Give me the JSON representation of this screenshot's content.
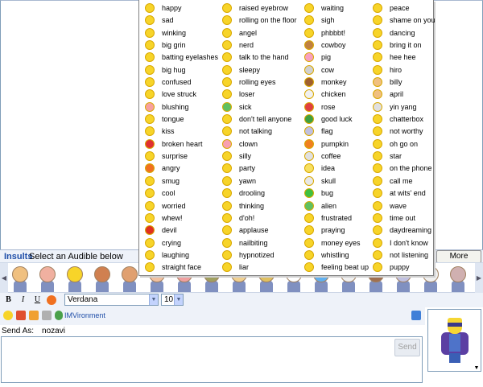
{
  "emoticons": [
    [
      "happy",
      "sad",
      "winking",
      "big grin",
      "batting eyelashes",
      "big hug",
      "confused",
      "love struck",
      "blushing",
      "tongue",
      "kiss",
      "broken heart",
      "surprise",
      "angry",
      "smug",
      "cool",
      "worried",
      "whew!",
      "devil",
      "crying",
      "laughing",
      "straight face"
    ],
    [
      "raised eyebrow",
      "rolling on the floor",
      "angel",
      "nerd",
      "talk to the hand",
      "sleepy",
      "rolling eyes",
      "loser",
      "sick",
      "don't tell anyone",
      "not talking",
      "clown",
      "silly",
      "party",
      "yawn",
      "drooling",
      "thinking",
      "d'oh!",
      "applause",
      "nailbiting",
      "hypnotized",
      "liar"
    ],
    [
      "waiting",
      "sigh",
      "phbbbt!",
      "cowboy",
      "pig",
      "cow",
      "monkey",
      "chicken",
      "rose",
      "good luck",
      "flag",
      "pumpkin",
      "coffee",
      "idea",
      "skull",
      "bug",
      "alien",
      "frustrated",
      "praying",
      "money eyes",
      "whistling",
      "feeling beat up"
    ],
    [
      "peace",
      "shame on you",
      "dancing",
      "bring it on",
      "hee hee",
      "hiro",
      "billy",
      "april",
      "yin yang",
      "chatterbox",
      "not worthy",
      "oh go on",
      "star",
      "on the phone",
      "call me",
      "at wits' end",
      "wave",
      "time out",
      "daydreaming",
      "I don't know",
      "not listening",
      "puppy"
    ]
  ],
  "emoticon_colors": [
    [
      "#f7d429",
      "#f7d429",
      "#f7d429",
      "#f7d429",
      "#f7d429",
      "#f7d429",
      "#f7d429",
      "#f7d429",
      "#f7a0a0",
      "#f7d429",
      "#f7d429",
      "#e03030",
      "#f7d429",
      "#f07020",
      "#f7d429",
      "#f7d429",
      "#f7d429",
      "#f7d429",
      "#e03020",
      "#f7d429",
      "#f7d429",
      "#f7d429"
    ],
    [
      "#f7d429",
      "#f7d429",
      "#f7d429",
      "#f7d429",
      "#f7d429",
      "#f7d429",
      "#f7d429",
      "#f7d429",
      "#60c060",
      "#f7d429",
      "#f7d429",
      "#f8a0b0",
      "#f7d429",
      "#f7d429",
      "#f7d429",
      "#f7d429",
      "#f7d429",
      "#f7d429",
      "#f7d429",
      "#f7d429",
      "#f7d429",
      "#f7d429"
    ],
    [
      "#f7d429",
      "#f7d429",
      "#f7d429",
      "#c08040",
      "#f8a0c0",
      "#d0d0d0",
      "#a06030",
      "#f0f0f0",
      "#e04040",
      "#40a040",
      "#c0c0e0",
      "#f08020",
      "#e0e0e0",
      "#f7e060",
      "#e8e8e8",
      "#40c040",
      "#60c060",
      "#f7d429",
      "#f7d429",
      "#f7d429",
      "#f7d429",
      "#f7d429"
    ],
    [
      "#f7d429",
      "#f7d429",
      "#f7d429",
      "#f7d429",
      "#f7d429",
      "#f7d429",
      "#f0c080",
      "#f0c080",
      "#e0e0e0",
      "#f7d429",
      "#f7d429",
      "#f7d429",
      "#f7d429",
      "#f7d429",
      "#f7d429",
      "#f7d429",
      "#f7d429",
      "#f7d429",
      "#f7d429",
      "#f7d429",
      "#f7d429",
      "#f7d429"
    ]
  ],
  "audibles_bar": {
    "tab_label": "Insults",
    "hint": "Select an Audible below",
    "more_button": "More Audibles"
  },
  "audible_colors": [
    "#f0c080",
    "#f0b0a0",
    "#f7d429",
    "#d08050",
    "#e0a070",
    "#f0c0a0",
    "#f0a0a0",
    "#a0a060",
    "#f0d090",
    "#e0c060",
    "#ffffff",
    "#60b0f0",
    "#f0f0f0",
    "#a07050",
    "#c0c0e0",
    "#f0f0f0",
    "#d0b0b0"
  ],
  "format_bar": {
    "bold": "B",
    "italic": "I",
    "underline": "U",
    "font": "Verdana",
    "size": "10",
    "dropdown_arrow": "▼"
  },
  "tools_bar": {
    "imvironment_label": "IMVironment"
  },
  "send_as": {
    "label": "Send As:",
    "name": "nozavi"
  },
  "send_button": "Send",
  "avatar_dropdown": "▼",
  "strip_arrows": {
    "left": "◀",
    "right": "▶"
  }
}
